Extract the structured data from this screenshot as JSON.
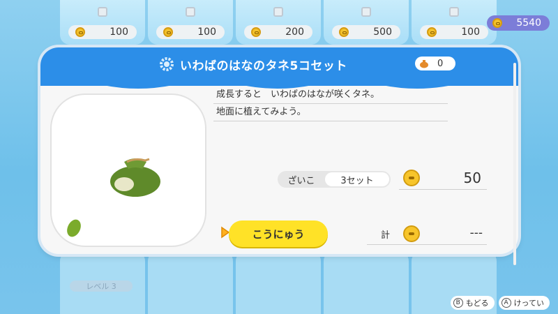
{
  "shop": {
    "prices": [
      "100",
      "100",
      "200",
      "500",
      "100"
    ],
    "wallet": "5540",
    "level_tag": "レベル 3"
  },
  "dialog": {
    "title": "いわばのはなのタネ5コセット",
    "owned_count": "0",
    "description": [
      "成長すると　いわばのはなが咲くタネ。",
      "地面に植えてみよう。"
    ],
    "stock_label": "ざいこ",
    "stock_value": "3セット",
    "unit_price": "50",
    "buy_label": "こうにゅう",
    "total_label": "計",
    "total_value": "---"
  },
  "hints": {
    "back_glyph": "B",
    "back_label": "もどる",
    "confirm_glyph": "A",
    "confirm_label": "けってい"
  },
  "colors": {
    "header_blue": "#2c8ee8",
    "buy_yellow": "#ffe227",
    "wallet_purple": "#7c7dd8"
  },
  "icons": [
    "gear-icon",
    "coin-icon",
    "seed-bag-icon",
    "seed-icon",
    "play-arrow-icon"
  ]
}
